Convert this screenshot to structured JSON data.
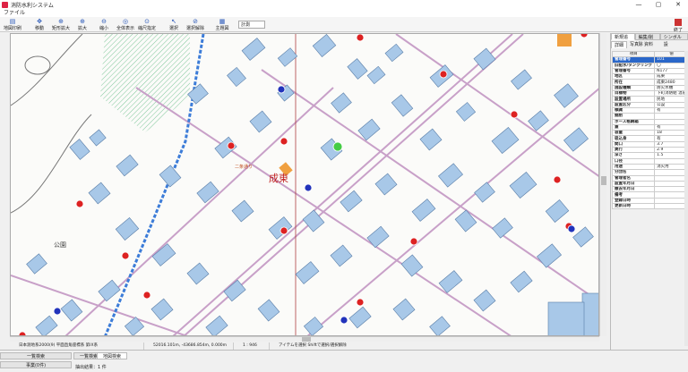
{
  "app": {
    "title": "消防水利システム"
  },
  "window_controls": {
    "minimize": "—",
    "maximize": "▢",
    "close": "✕"
  },
  "menu": {
    "file": "ファイル"
  },
  "toolbar": {
    "tools": [
      {
        "label": "地図印刷",
        "icon": "printer-icon",
        "glyph": "▤"
      },
      {
        "label": "移動",
        "icon": "hand-icon",
        "glyph": "✥"
      },
      {
        "label": "矩形拡大",
        "icon": "zoom-rect-icon",
        "glyph": "⊕"
      },
      {
        "label": "拡大",
        "icon": "zoom-in-icon",
        "glyph": "⊕"
      },
      {
        "label": "縮小",
        "icon": "zoom-out-icon",
        "glyph": "⊖"
      },
      {
        "label": "全体表示",
        "icon": "fit-all-icon",
        "glyph": "◎"
      },
      {
        "label": "縮尺指定",
        "icon": "scale-icon",
        "glyph": "⊙"
      },
      {
        "label": "選択",
        "icon": "pointer-icon",
        "glyph": "↖"
      },
      {
        "label": "選択解除",
        "icon": "deselect-icon",
        "glyph": "⊘"
      },
      {
        "label": "主題図",
        "icon": "theme-map-icon",
        "glyph": "▦"
      }
    ],
    "scale_select": "計測",
    "exit_label": "終了"
  },
  "map": {
    "district_label": "成東",
    "district_sublabel": "二条通り",
    "park_label": "公園",
    "colors": {
      "road": "#c8a0c8",
      "building": "#a8c8e8",
      "blue_road": "#3c7cd8",
      "hydrant": "#d22",
      "cistern": "#2233bb",
      "selected": "#44cc44",
      "public": "#f0a040"
    }
  },
  "statusbar": {
    "coord_system": "日本測地系2000(9) 平面直角座標系 第IX系",
    "coordinates": "52016.101m, -43686.854m, 0.000m",
    "scale": "1 : 946",
    "hint": "アイテムを選択  Shiftで選択/選択解除"
  },
  "bottom": {
    "left_tab": "一覧検索",
    "left_tab2": "事業(0件)",
    "tabs": [
      "一覧検索",
      "地図検索"
    ],
    "result_count": "抽出結果：1 件"
  },
  "panel": {
    "tabs": [
      "新規追加",
      "編集/削除",
      "シンボル設"
    ],
    "subtabs": [
      "詳細",
      "写真",
      "資料"
    ],
    "header": {
      "key": "項目",
      "value": "値"
    },
    "rows": [
      {
        "k": "管理番号",
        "v": "101",
        "sel": true
      },
      {
        "k": "旧配水/タンクリング",
        "v": "〇"
      },
      {
        "k": "管理番号",
        "v": "N177"
      },
      {
        "k": "地区",
        "v": "成東"
      },
      {
        "k": "所在",
        "v": "成東2480"
      },
      {
        "k": "施設種類",
        "v": "防火水槽"
      },
      {
        "k": "目標物",
        "v": "下町消防組  温泉"
      },
      {
        "k": "設置場所",
        "v": "民地"
      },
      {
        "k": "設置区分",
        "v": "公設"
      },
      {
        "k": "標識",
        "v": "有"
      },
      {
        "k": "掘削",
        "v": ""
      },
      {
        "k": "ホース格納箱",
        "v": ""
      },
      {
        "k": "蓋",
        "v": "有"
      },
      {
        "k": "容量",
        "v": "18"
      },
      {
        "k": "吸込身",
        "v": "有"
      },
      {
        "k": "間口",
        "v": "3.7"
      },
      {
        "k": "奥行",
        "v": "2.9"
      },
      {
        "k": "深さ",
        "v": "1.5"
      },
      {
        "k": "口径",
        "v": ""
      },
      {
        "k": "用途",
        "v": "消火用"
      },
      {
        "k": "分団名",
        "v": ""
      },
      {
        "k": "管理者名",
        "v": ""
      },
      {
        "k": "設置年月日",
        "v": ""
      },
      {
        "k": "撤去年月日",
        "v": ""
      },
      {
        "k": "備考",
        "v": ""
      },
      {
        "k": "登録日時",
        "v": ""
      },
      {
        "k": "更新日時",
        "v": ""
      }
    ]
  }
}
